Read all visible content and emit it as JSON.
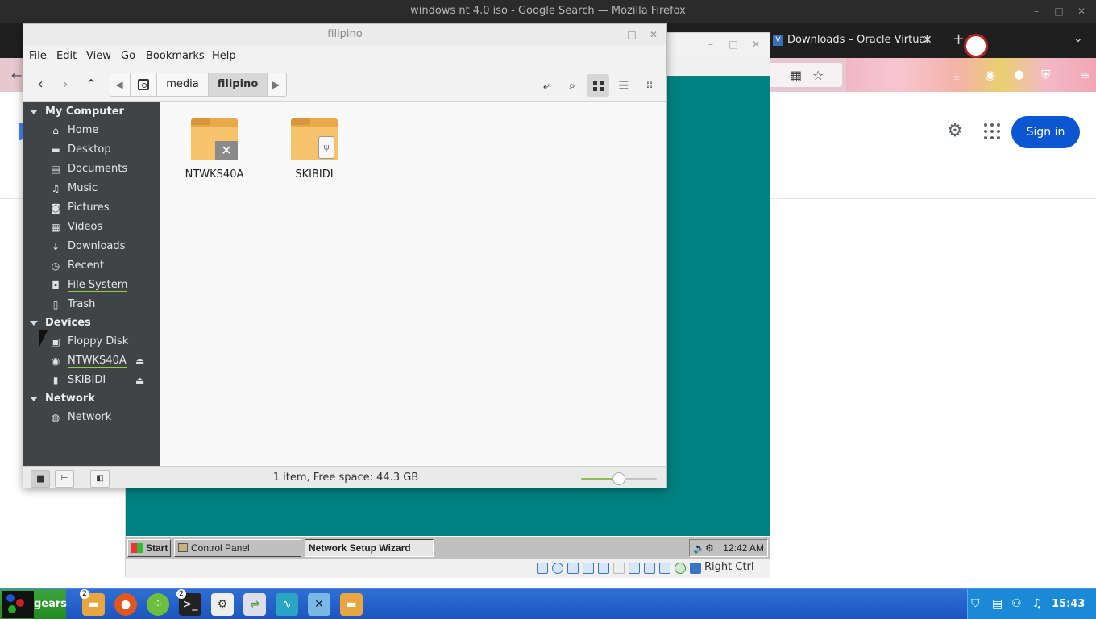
{
  "firefox": {
    "window_title": "windows nt 4.0 iso - Google Search — Mozilla Firefox",
    "tab_title": "Downloads – Oracle Virtual",
    "tab_close": "✕",
    "new_tab": "+",
    "google": {
      "sign_in_label": "Sign in",
      "settings_icon": "gear-icon",
      "apps_icon": "apps-grid-icon"
    }
  },
  "virtualbox": {
    "nt_taskbar": {
      "start_label": "Start",
      "tasks": [
        "Control Panel",
        "Network Setup Wizard"
      ],
      "clock": "12:42 AM"
    },
    "host_key_label": "Right Ctrl"
  },
  "file_manager": {
    "window_title": "filipino",
    "menu": [
      "File",
      "Edit",
      "View",
      "Go",
      "Bookmarks",
      "Help"
    ],
    "breadcrumbs": [
      "media",
      "filipino"
    ],
    "sidebar": {
      "sections": [
        {
          "title": "My Computer",
          "items": [
            {
              "label": "Home",
              "icon": "home-icon"
            },
            {
              "label": "Desktop",
              "icon": "desktop-icon"
            },
            {
              "label": "Documents",
              "icon": "documents-icon"
            },
            {
              "label": "Music",
              "icon": "music-icon"
            },
            {
              "label": "Pictures",
              "icon": "camera-icon"
            },
            {
              "label": "Videos",
              "icon": "film-icon"
            },
            {
              "label": "Downloads",
              "icon": "download-icon"
            },
            {
              "label": "Recent",
              "icon": "clock-icon"
            },
            {
              "label": "File System",
              "icon": "drive-icon"
            },
            {
              "label": "Trash",
              "icon": "trash-icon"
            }
          ]
        },
        {
          "title": "Devices",
          "items": [
            {
              "label": "Floppy Disk",
              "icon": "floppy-icon"
            },
            {
              "label": "NTWKS40A",
              "icon": "disc-icon"
            },
            {
              "label": "SKIBIDI",
              "icon": "usb-icon"
            }
          ]
        },
        {
          "title": "Network",
          "items": [
            {
              "label": "Network",
              "icon": "globe-icon"
            }
          ]
        }
      ]
    },
    "files": [
      {
        "name": "NTWKS40A",
        "emblem": "unmounted-x"
      },
      {
        "name": "SKIBIDI",
        "emblem": "usb-drive"
      }
    ],
    "status_text": "1 item, Free space: 44.3 GB",
    "zoom_level": 0.5
  },
  "taskbar": {
    "menu_label": "gears",
    "badges": [
      "2",
      "2"
    ],
    "clock": "15:43"
  },
  "colors": {
    "nt_desktop": "#008080",
    "sidebar_bg": "#414446",
    "accent_green": "#8fcf48",
    "sign_in_blue": "#0b57d0",
    "taskbar_blue": "#1c55bf"
  }
}
